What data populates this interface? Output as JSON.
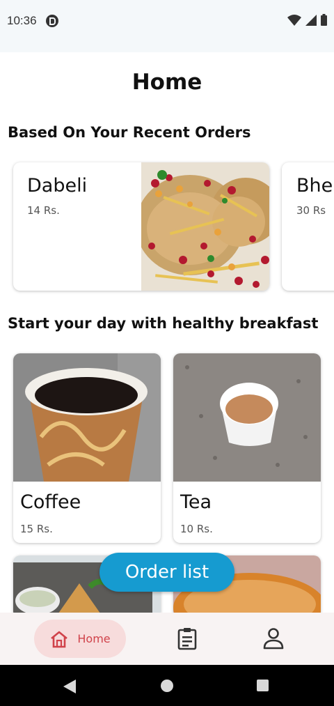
{
  "status_bar": {
    "time": "10:36",
    "icons": [
      "p-icon",
      "wifi-icon",
      "signal-icon",
      "battery-icon"
    ]
  },
  "page": {
    "title": "Home"
  },
  "recent_orders": {
    "title": "Based On Your Recent Orders",
    "items": [
      {
        "name": "Dabeli",
        "price": "14 Rs."
      },
      {
        "name": "Bhe",
        "price": "30 Rs"
      }
    ]
  },
  "breakfast": {
    "title": "Start your day with healthy breakfast",
    "items": [
      {
        "name": "Coffee",
        "price": "15 Rs."
      },
      {
        "name": "Tea",
        "price": "10 Rs."
      }
    ]
  },
  "fab": {
    "label": "Order list"
  },
  "bottom_nav": {
    "home_label": "Home",
    "accent_color": "#d0424a",
    "active_bg": "#f7dcdc"
  },
  "colors": {
    "fab_bg": "#169bd0",
    "status_bg": "#f4f8fa"
  }
}
